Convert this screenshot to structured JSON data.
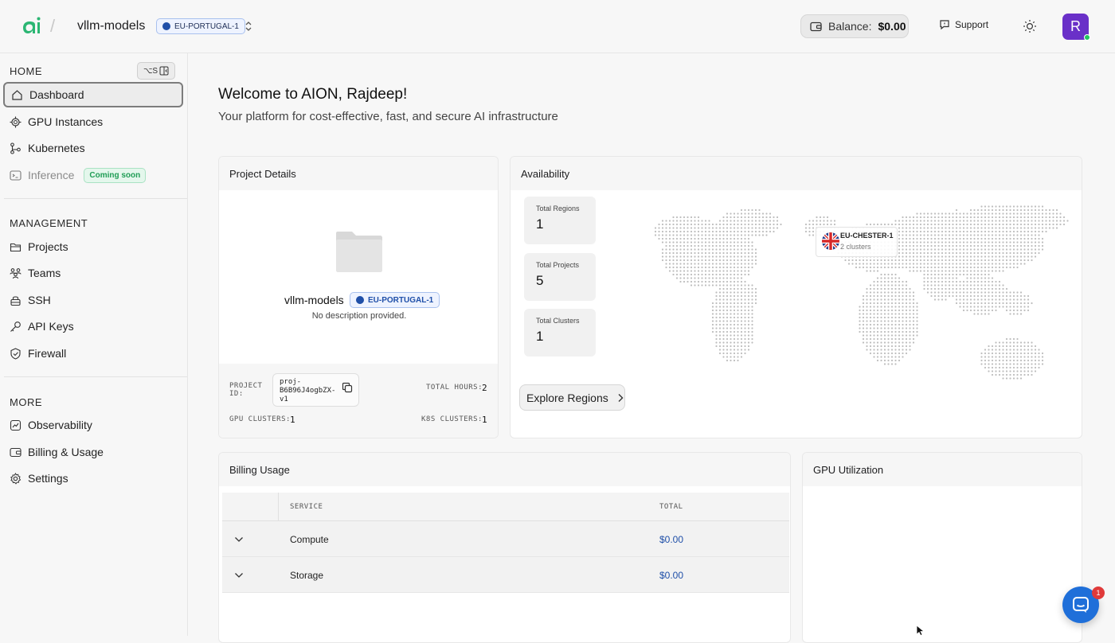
{
  "header": {
    "project_name": "vllm-models",
    "region": "EU-PORTUGAL-1",
    "balance_label": "Balance:",
    "balance_value": "$0.00",
    "support": "Support",
    "avatar_initial": "R"
  },
  "sidebar": {
    "home_title": "HOME",
    "shortcut": "⌥S",
    "home_items": [
      {
        "label": "Dashboard",
        "icon": "home-icon"
      },
      {
        "label": "GPU Instances",
        "icon": "chip-icon"
      },
      {
        "label": "Kubernetes",
        "icon": "git-branch-icon"
      },
      {
        "label": "Inference",
        "icon": "terminal-icon",
        "badge": "Coming soon"
      }
    ],
    "management_title": "MANAGEMENT",
    "management_items": [
      {
        "label": "Projects",
        "icon": "folder-icon"
      },
      {
        "label": "Teams",
        "icon": "users-icon"
      },
      {
        "label": "SSH",
        "icon": "lock-icon"
      },
      {
        "label": "API Keys",
        "icon": "key-icon"
      },
      {
        "label": "Firewall",
        "icon": "shield-icon"
      }
    ],
    "more_title": "MORE",
    "more_items": [
      {
        "label": "Observability",
        "icon": "chart-icon"
      },
      {
        "label": "Billing & Usage",
        "icon": "wallet-icon"
      },
      {
        "label": "Settings",
        "icon": "gear-icon"
      }
    ]
  },
  "main": {
    "welcome": "Welcome to AION, Rajdeep!",
    "subtitle": "Your platform for cost-effective, fast, and secure AI infrastructure",
    "project_card": {
      "title": "Project Details",
      "name": "vllm-models",
      "region": "EU-PORTUGAL-1",
      "description": "No description provided.",
      "project_id_label1": "PROJECT",
      "project_id_label2": "ID:",
      "project_id_line1": "proj-",
      "project_id_line2": "B6B96J4ogbZX-",
      "project_id_line3": "v1",
      "total_hours_label": "TOTAL HOURS:",
      "total_hours": "2",
      "gpu_clusters_label": "GPU CLUSTERS:",
      "gpu_clusters": "1",
      "k8s_clusters_label": "K8S CLUSTERS:",
      "k8s_clusters": "1"
    },
    "availability": {
      "title": "Availability",
      "stats": [
        {
          "label": "Total Regions",
          "value": "1"
        },
        {
          "label": "Total Projects",
          "value": "5"
        },
        {
          "label": "Total Clusters",
          "value": "1"
        }
      ],
      "explore": "Explore Regions",
      "cluster_name": "EU-CHESTER-1",
      "cluster_sub": "2 clusters"
    },
    "billing": {
      "title": "Billing Usage",
      "col_service": "SERVICE",
      "col_total": "TOTAL",
      "rows": [
        {
          "service": "Compute",
          "total": "$0.00"
        },
        {
          "service": "Storage",
          "total": "$0.00"
        }
      ]
    },
    "gpu_util": {
      "title": "GPU Utilization"
    }
  },
  "chat": {
    "badge": "1"
  },
  "colors": {
    "accent": "#1f4fa8",
    "brand_green": "#1f9d55",
    "avatar": "#6a30c8",
    "chat": "#1f6fd9"
  }
}
